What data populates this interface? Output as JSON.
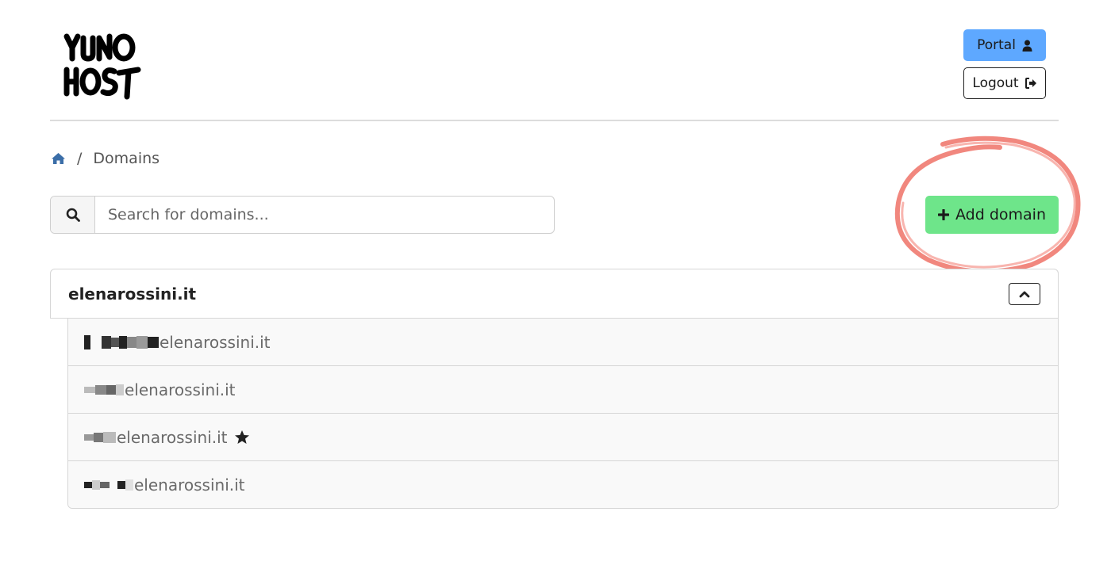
{
  "header": {
    "logo_alt": "YUNO HOST",
    "portal_label": "Portal",
    "logout_label": "Logout"
  },
  "breadcrumb": {
    "home_icon": "home-icon",
    "separator": "/",
    "current": "Domains"
  },
  "search": {
    "placeholder": "Search for domains...",
    "icon": "search-icon"
  },
  "actions": {
    "add_domain_label": "Add domain",
    "add_icon": "plus-icon"
  },
  "domain_group": {
    "title": "elenarossini.it",
    "collapse_icon": "chevron-up-icon",
    "subdomains": [
      {
        "suffix": "elenarossini.it",
        "is_main": false
      },
      {
        "suffix": "elenarossini.it",
        "is_main": false
      },
      {
        "suffix": "elenarossini.it",
        "is_main": true
      },
      {
        "suffix": "elenarossini.it",
        "is_main": false
      }
    ]
  },
  "colors": {
    "portal_button": "#5ea8ff",
    "add_button": "#6ee58a",
    "annotation_circle": "#f07a70",
    "home_icon": "#3b6ea8"
  }
}
